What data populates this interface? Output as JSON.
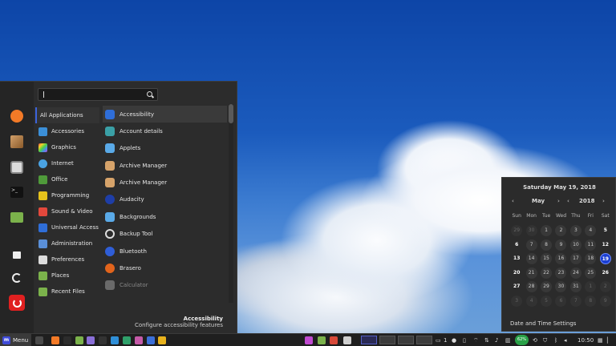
{
  "search": {
    "value": "",
    "placeholder": ""
  },
  "favorites": [
    {
      "icon": "firefox-icon",
      "color": "#f37a27"
    },
    {
      "icon": "package-icon",
      "color": "#b98a5a"
    },
    {
      "icon": "settings-icon",
      "color": "#dcdcdc"
    },
    {
      "icon": "terminal-icon",
      "color": "#1c1c1c"
    },
    {
      "icon": "folder-icon",
      "color": "#7bb24b"
    },
    {
      "icon": "lock-icon",
      "color": "#2a2a2a"
    },
    {
      "icon": "logout-icon",
      "color": "#2a2a2a"
    },
    {
      "icon": "power-icon",
      "color": "#e02020"
    }
  ],
  "categories": [
    {
      "label": "All Applications",
      "icon": "all-apps-icon",
      "color": "#2b2b2b"
    },
    {
      "label": "Accessories",
      "icon": "accessories-icon",
      "color": "#3b8fd8"
    },
    {
      "label": "Graphics",
      "icon": "graphics-icon",
      "color": "#c94bc2"
    },
    {
      "label": "Internet",
      "icon": "internet-icon",
      "color": "#4aa3e3"
    },
    {
      "label": "Office",
      "icon": "office-icon",
      "color": "#4f9a3a"
    },
    {
      "label": "Programming",
      "icon": "programming-icon",
      "color": "#e6c21c"
    },
    {
      "label": "Sound & Video",
      "icon": "sound-video-icon",
      "color": "#e2483c"
    },
    {
      "label": "Universal Access",
      "icon": "universal-access-icon",
      "color": "#2f6ed8"
    },
    {
      "label": "Administration",
      "icon": "administration-icon",
      "color": "#5a8fd8"
    },
    {
      "label": "Preferences",
      "icon": "preferences-icon",
      "color": "#dcdcdc"
    },
    {
      "label": "Places",
      "icon": "places-icon",
      "color": "#7bb24b"
    },
    {
      "label": "Recent Files",
      "icon": "recent-files-icon",
      "color": "#7bb24b"
    }
  ],
  "apps": [
    {
      "label": "Accessibility",
      "icon": "accessibility-icon",
      "color": "#2f6ed8"
    },
    {
      "label": "Account details",
      "icon": "account-icon",
      "color": "#3aa0a6"
    },
    {
      "label": "Applets",
      "icon": "applets-icon",
      "color": "#5aaae8"
    },
    {
      "label": "Archive Manager",
      "icon": "archive-icon",
      "color": "#d6a36a"
    },
    {
      "label": "Archive Manager",
      "icon": "archive-icon",
      "color": "#d6a36a"
    },
    {
      "label": "Audacity",
      "icon": "audacity-icon",
      "color": "#1e3ea8"
    },
    {
      "label": "Backgrounds",
      "icon": "backgrounds-icon",
      "color": "#5aaae8"
    },
    {
      "label": "Backup Tool",
      "icon": "backup-icon",
      "color": "#3a3a3a"
    },
    {
      "label": "Bluetooth",
      "icon": "bluetooth-icon",
      "color": "#2f5ed8"
    },
    {
      "label": "Brasero",
      "icon": "brasero-icon",
      "color": "#e2641c"
    },
    {
      "label": "Calculator",
      "icon": "calculator-icon",
      "color": "#6a6a6a"
    }
  ],
  "description": {
    "title": "Accessibility",
    "text": "Configure accessibility features"
  },
  "calendar": {
    "date_label": "Saturday May 19, 2018",
    "month": "May",
    "year": "2018",
    "prev_arrow": "‹",
    "next_arrow": "›",
    "weekdays": [
      "Sun",
      "Mon",
      "Tue",
      "Wed",
      "Thu",
      "Fri",
      "Sat"
    ],
    "weeks": [
      [
        {
          "d": "29",
          "o": true
        },
        {
          "d": "30",
          "o": true
        },
        {
          "d": "1"
        },
        {
          "d": "2"
        },
        {
          "d": "3"
        },
        {
          "d": "4"
        },
        {
          "d": "5",
          "b": true
        }
      ],
      [
        {
          "d": "6",
          "b": true
        },
        {
          "d": "7"
        },
        {
          "d": "8"
        },
        {
          "d": "9"
        },
        {
          "d": "10"
        },
        {
          "d": "11"
        },
        {
          "d": "12",
          "b": true
        }
      ],
      [
        {
          "d": "13",
          "b": true
        },
        {
          "d": "14"
        },
        {
          "d": "15"
        },
        {
          "d": "16"
        },
        {
          "d": "17"
        },
        {
          "d": "18"
        },
        {
          "d": "19",
          "t": true
        }
      ],
      [
        {
          "d": "20",
          "b": true
        },
        {
          "d": "21"
        },
        {
          "d": "22"
        },
        {
          "d": "23"
        },
        {
          "d": "24"
        },
        {
          "d": "25"
        },
        {
          "d": "26",
          "b": true
        }
      ],
      [
        {
          "d": "27",
          "b": true
        },
        {
          "d": "28"
        },
        {
          "d": "29"
        },
        {
          "d": "30"
        },
        {
          "d": "31"
        },
        {
          "d": "1",
          "o": true
        },
        {
          "d": "2",
          "o": true
        }
      ],
      [
        {
          "d": "3",
          "o": true
        },
        {
          "d": "4",
          "o": true
        },
        {
          "d": "5",
          "o": true
        },
        {
          "d": "6",
          "o": true
        },
        {
          "d": "7",
          "o": true
        },
        {
          "d": "8",
          "o": true
        },
        {
          "d": "9",
          "o": true
        }
      ]
    ],
    "settings_label": "Date and Time Settings"
  },
  "taskbar": {
    "menu_label": "Menu",
    "menu_logo": "m",
    "launchers": [
      {
        "icon": "show-desktop-icon",
        "color": "#4a4a4a"
      },
      {
        "icon": "firefox-icon",
        "color": "#f37a27"
      },
      {
        "icon": "terminal-icon",
        "color": "#2c2c2c"
      },
      {
        "icon": "folder-icon",
        "color": "#7bb24b"
      },
      {
        "icon": "text-editor-icon",
        "color": "#8a6fd8"
      },
      {
        "icon": "terminal-dark-icon",
        "color": "#333333"
      },
      {
        "icon": "screenshot-icon",
        "color": "#2f8fd8"
      },
      {
        "icon": "calculator-icon",
        "color": "#2fa06a"
      },
      {
        "icon": "package-icon",
        "color": "#c55aa8"
      },
      {
        "icon": "network-icon",
        "color": "#3b6fd8"
      },
      {
        "icon": "chrome-icon",
        "color": "#e8b21c"
      },
      {
        "icon": "mixer-icon",
        "color": "#c04ad0"
      },
      {
        "icon": "files-icon",
        "color": "#7bb24b"
      },
      {
        "icon": "chrome-icon",
        "color": "#d84a3a"
      },
      {
        "icon": "image-viewer-icon",
        "color": "#cfcfcf"
      }
    ],
    "notifications_count": "1",
    "battery_percent": "62%",
    "clock": "10:50"
  }
}
